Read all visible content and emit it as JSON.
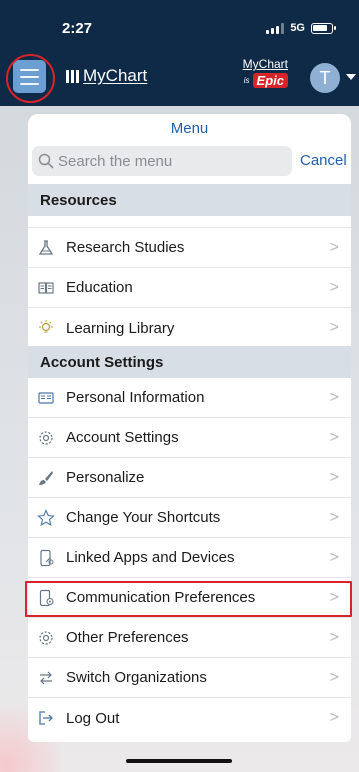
{
  "status_bar": {
    "time": "2:27",
    "network": "5G"
  },
  "header": {
    "brand_name_prefix": "My",
    "brand_name_suffix": "Chart",
    "partner_logo_top": "MyChart",
    "partner_logo_is": "is",
    "partner_logo_badge": "Epic",
    "avatar_initial": "T",
    "accent_color": "#6b9fd1"
  },
  "menu": {
    "title": "Menu",
    "search_placeholder": "Search the menu",
    "cancel_label": "Cancel",
    "sections": [
      {
        "title": "Resources",
        "items": [
          {
            "label": "Research Studies",
            "icon": "flask-icon"
          },
          {
            "label": "Education",
            "icon": "book-icon"
          },
          {
            "label": "Learning Library",
            "icon": "lightbulb-icon"
          }
        ]
      },
      {
        "title": "Account Settings",
        "items": [
          {
            "label": "Personal Information",
            "icon": "id-card-icon"
          },
          {
            "label": "Account Settings",
            "icon": "gear-icon"
          },
          {
            "label": "Personalize",
            "icon": "paintbrush-icon"
          },
          {
            "label": "Change Your Shortcuts",
            "icon": "star-icon"
          },
          {
            "label": "Linked Apps and Devices",
            "icon": "phone-link-icon"
          },
          {
            "label": "Communication Preferences",
            "icon": "phone-settings-icon"
          },
          {
            "label": "Other Preferences",
            "icon": "gear-icon"
          },
          {
            "label": "Switch Organizations",
            "icon": "swap-arrows-icon"
          },
          {
            "label": "Log Out",
            "icon": "logout-icon"
          }
        ]
      }
    ],
    "chevron": ">"
  },
  "colors": {
    "header_bg": "#0f2a47",
    "link_blue": "#2460a7",
    "section_bg": "#d7dee6",
    "highlight_red": "#d6242a"
  }
}
